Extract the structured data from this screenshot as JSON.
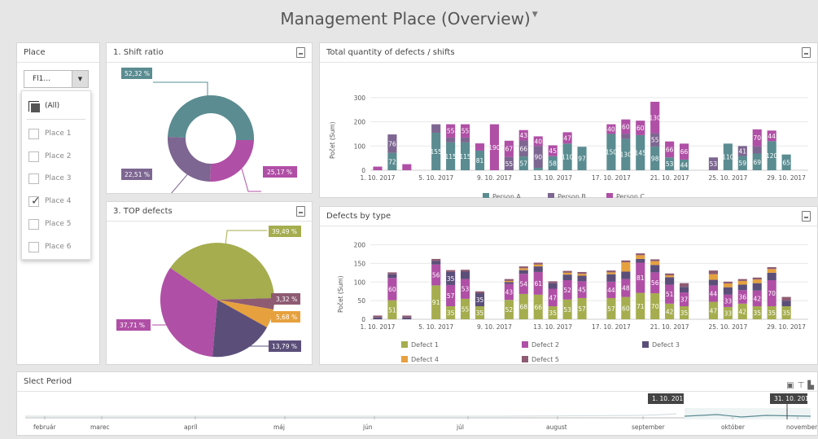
{
  "title": "Management Place (Overview)",
  "title_caret": "▼",
  "colors": {
    "teal": "#5a8c91",
    "purple": "#7d6691",
    "magenta": "#b04fa6",
    "olive": "#a5ad4e",
    "dark_purple": "#5b4f7a",
    "orange": "#e6a13e",
    "mauve": "#8e5b72"
  },
  "place_panel": {
    "header": "Place",
    "selected": "Fl1...",
    "all_label": "(All)",
    "options": [
      "Place 1",
      "Place 2",
      "Place 3",
      "Place 4",
      "Place 5",
      "Place 6"
    ],
    "checked": "Place 4"
  },
  "shift_ratio": {
    "header": "1. Shift ratio",
    "labels": [
      "52,32 %",
      "22,51 %",
      "25,17 %"
    ]
  },
  "top_defects": {
    "header": "3. TOP defects",
    "labels": [
      "39,49 %",
      "3,32 %",
      "5,68 %",
      "13,79 %",
      "37,71 %"
    ]
  },
  "total_qty": {
    "header": "Total quantity of defects / shifts",
    "ylabel": "Počet (Sum)",
    "yticks": [
      "300",
      "200",
      "100",
      "0"
    ],
    "xticks": [
      "1. 10. 2017",
      "5. 10. 2017",
      "9. 10. 2017",
      "13. 10. 2017",
      "17. 10. 2017",
      "21. 10. 2017",
      "25. 10. 2017",
      "29. 10. 2017"
    ],
    "legend": [
      "Person A",
      "Person B",
      "Person C"
    ]
  },
  "defects_type": {
    "header": "Defects by type",
    "ylabel": "Počet (Sum)",
    "yticks": [
      "200",
      "150",
      "100",
      "50",
      "0"
    ],
    "xticks": [
      "1. 10. 2017",
      "5. 10. 2017",
      "9. 10. 2017",
      "13. 10. 2017",
      "17. 10. 2017",
      "21. 10. 2017",
      "25. 10. 2017",
      "29. 10. 2017"
    ],
    "legend": [
      "Defect 1",
      "Defect 2",
      "Defect 3",
      "Defect 4",
      "Defect 5"
    ]
  },
  "period": {
    "header": "Slect Period",
    "months": [
      "február",
      "marec",
      "apríl",
      "máj",
      "jún",
      "júl",
      "august",
      "september",
      "október",
      "november"
    ],
    "start_label": "1. 10. 2017",
    "end_label": "31. 10. 2017"
  },
  "chart_data": [
    {
      "type": "bar",
      "title": "Total quantity of defects / shifts",
      "ylabel": "Počet (Sum)",
      "ylim": [
        0,
        330
      ],
      "x": [
        1,
        2,
        3,
        4,
        5,
        6,
        7,
        8,
        9,
        10,
        11,
        12,
        13,
        14,
        15,
        16,
        17,
        18,
        19,
        20,
        21,
        22,
        23,
        24,
        25,
        26,
        27,
        28,
        29,
        30
      ],
      "series": [
        {
          "name": "Person A",
          "values": [
            0,
            72,
            0,
            0,
            155,
            115,
            115,
            81,
            0,
            0,
            57,
            10,
            58,
            110,
            97,
            0,
            150,
            130,
            145,
            98,
            53,
            44,
            0,
            0,
            110,
            59,
            69,
            120,
            65,
            0
          ]
        },
        {
          "name": "Person B",
          "values": [
            0,
            76,
            0,
            0,
            35,
            20,
            20,
            0,
            0,
            55,
            66,
            90,
            0,
            0,
            0,
            0,
            0,
            20,
            0,
            55,
            0,
            0,
            0,
            53,
            0,
            41,
            30,
            0,
            0,
            0
          ]
        },
        {
          "name": "Person C",
          "values": [
            15,
            0,
            25,
            0,
            0,
            55,
            55,
            30,
            190,
            67,
            43,
            40,
            45,
            47,
            0,
            0,
            40,
            60,
            60,
            130,
            66,
            66,
            0,
            0,
            0,
            0,
            70,
            44,
            0,
            0
          ]
        }
      ]
    },
    {
      "type": "bar",
      "title": "Defects by type",
      "ylabel": "Počet (Sum)",
      "ylim": [
        0,
        210
      ],
      "x": [
        1,
        2,
        3,
        4,
        5,
        6,
        7,
        8,
        9,
        10,
        11,
        12,
        13,
        14,
        15,
        16,
        17,
        18,
        19,
        20,
        21,
        22,
        23,
        24,
        25,
        26,
        27,
        28,
        29,
        30
      ],
      "series": [
        {
          "name": "Defect 1",
          "values": [
            0,
            51,
            0,
            0,
            91,
            35,
            55,
            35,
            0,
            52,
            68,
            66,
            35,
            53,
            57,
            0,
            57,
            60,
            71,
            70,
            42,
            35,
            0,
            47,
            33,
            42,
            35,
            35,
            35,
            0
          ]
        },
        {
          "name": "Defect 2",
          "values": [
            0,
            60,
            0,
            0,
            56,
            57,
            53,
            0,
            0,
            43,
            54,
            61,
            47,
            52,
            45,
            0,
            44,
            48,
            81,
            56,
            51,
            37,
            0,
            44,
            33,
            36,
            42,
            70,
            0,
            0
          ]
        },
        {
          "name": "Defect 3",
          "values": [
            5,
            10,
            5,
            0,
            10,
            35,
            20,
            35,
            0,
            5,
            10,
            15,
            15,
            15,
            15,
            0,
            20,
            20,
            10,
            20,
            20,
            15,
            0,
            15,
            20,
            15,
            20,
            20,
            15,
            0
          ]
        },
        {
          "name": "Defect 4",
          "values": [
            0,
            0,
            0,
            0,
            0,
            0,
            0,
            0,
            0,
            3,
            5,
            5,
            0,
            5,
            5,
            0,
            5,
            25,
            10,
            10,
            5,
            0,
            0,
            15,
            10,
            10,
            10,
            10,
            0,
            0
          ]
        },
        {
          "name": "Defect 5",
          "values": [
            5,
            5,
            5,
            0,
            5,
            5,
            5,
            5,
            0,
            5,
            5,
            5,
            5,
            5,
            5,
            0,
            5,
            5,
            5,
            5,
            5,
            10,
            0,
            10,
            5,
            5,
            5,
            5,
            10,
            0
          ]
        }
      ]
    },
    {
      "type": "pie",
      "title": "1. Shift ratio",
      "categories": [
        "",
        "",
        ""
      ],
      "values": [
        52.32,
        25.17,
        22.51
      ]
    },
    {
      "type": "pie",
      "title": "3. TOP defects",
      "categories": [
        "",
        "",
        "",
        "",
        ""
      ],
      "values": [
        39.49,
        3.32,
        5.68,
        13.79,
        37.71
      ]
    }
  ]
}
